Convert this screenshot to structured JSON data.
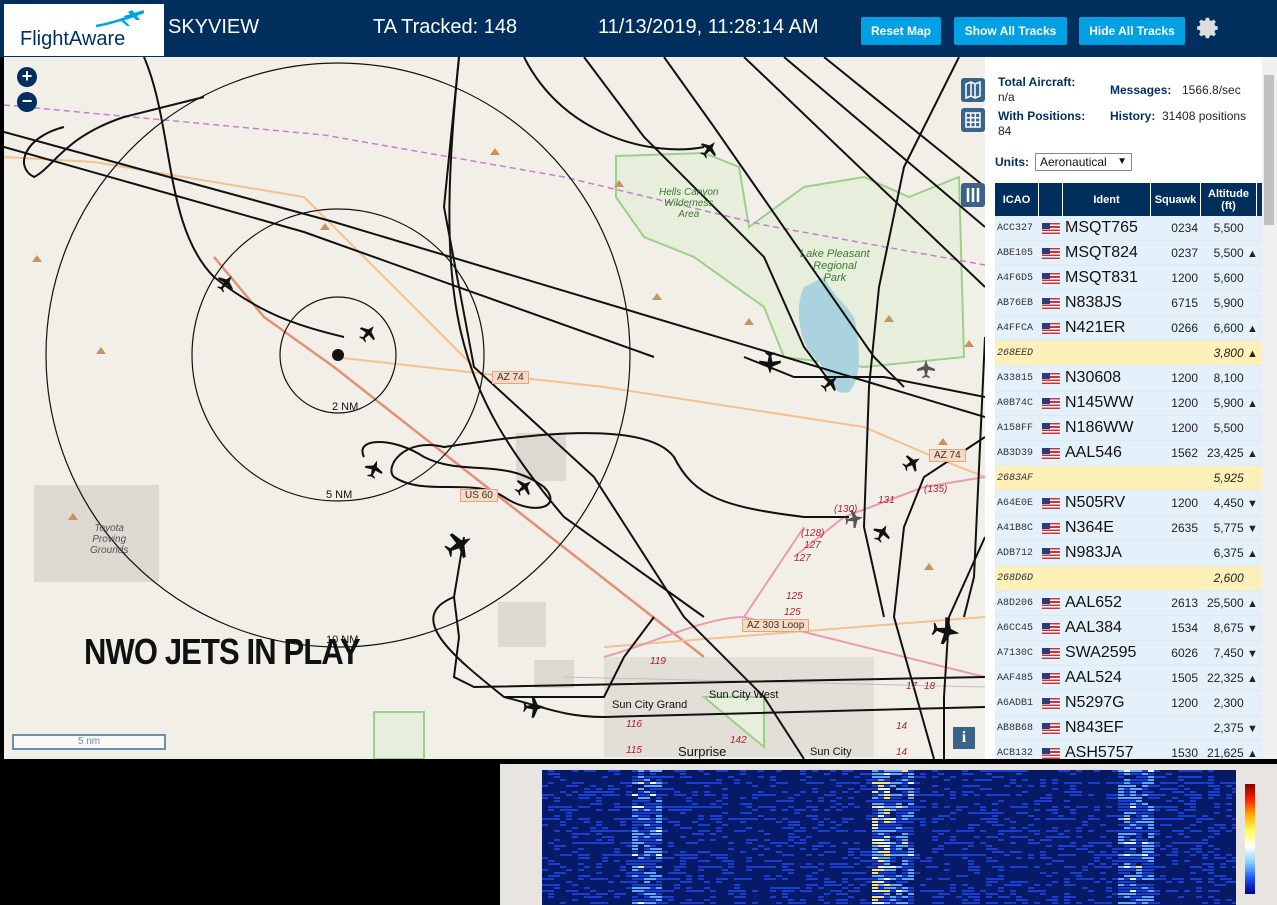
{
  "header": {
    "logo_text": "FlightAware",
    "app_name": "SKYVIEW",
    "tracked": "TA Tracked: 148",
    "datetime": "11/13/2019, 11:28:14 AM",
    "buttons": {
      "reset": "Reset Map",
      "show_all": "Show All Tracks",
      "hide_all": "Hide All Tracks"
    }
  },
  "map": {
    "overlay_caption": "NWO JETS IN PLAY",
    "zoom_in": "+",
    "zoom_out": "−",
    "scale_label": "5 nm",
    "info_label": "i",
    "rings": [
      "2 NM",
      "5 NM",
      "10 NM"
    ],
    "labels": {
      "hells_canyon": "Hells Canyon\nWilderness\nArea",
      "lake_pleasant": "Lake Pleasant\nRegional\nPark",
      "toyota": "Toyota\nProving\nGrounds",
      "sun_city_grand": "Sun City Grand",
      "sun_city_west": "Sun City West",
      "surprise": "Surprise",
      "sun_city": "Sun City"
    },
    "roads": {
      "az74_a": "AZ 74",
      "az74_b": "AZ 74",
      "us60": "US 60",
      "az303": "AZ 303 Loop"
    },
    "route_numbers": [
      "(130)",
      "131",
      "(135)",
      "(128)",
      "127",
      "127",
      "125",
      "125",
      "119",
      "116",
      "115",
      "142",
      "14",
      "14",
      "17",
      "18"
    ]
  },
  "sidebar": {
    "total_aircraft_label": "Total Aircraft:",
    "total_aircraft_value": "n/a",
    "messages_label": "Messages:",
    "messages_value": "1566.8/sec",
    "with_positions_label": "With Positions:",
    "with_positions_value": "84",
    "history_label": "History:",
    "history_value": "31408 positions",
    "units_label": "Units:",
    "units_value": "Aeronautical",
    "columns": [
      "ICAO",
      "",
      "Ident",
      "Squawk",
      "Altitude (ft)"
    ],
    "rows": [
      {
        "icao": "ACC327",
        "flag": true,
        "ident": "MSQT765",
        "squawk": "0234",
        "alt": "5,500",
        "trend": "",
        "gold": false
      },
      {
        "icao": "ABE105",
        "flag": true,
        "ident": "MSQT824",
        "squawk": "0237",
        "alt": "5,500",
        "trend": "▲",
        "gold": false
      },
      {
        "icao": "A4F6D5",
        "flag": true,
        "ident": "MSQT831",
        "squawk": "1200",
        "alt": "5,600",
        "trend": "",
        "gold": false
      },
      {
        "icao": "AB76EB",
        "flag": true,
        "ident": "N838JS",
        "squawk": "6715",
        "alt": "5,900",
        "trend": "",
        "gold": false
      },
      {
        "icao": "A4FFCA",
        "flag": true,
        "ident": "N421ER",
        "squawk": "0266",
        "alt": "6,600",
        "trend": "▲",
        "gold": false
      },
      {
        "icao": "268EED",
        "flag": false,
        "ident": "",
        "squawk": "",
        "alt": "3,800",
        "trend": "▲",
        "gold": true
      },
      {
        "icao": "A33815",
        "flag": true,
        "ident": "N30608",
        "squawk": "1200",
        "alt": "8,100",
        "trend": "",
        "gold": false
      },
      {
        "icao": "A0B74C",
        "flag": true,
        "ident": "N145WW",
        "squawk": "1200",
        "alt": "5,900",
        "trend": "▲",
        "gold": false
      },
      {
        "icao": "A158FF",
        "flag": true,
        "ident": "N186WW",
        "squawk": "1200",
        "alt": "5,500",
        "trend": "",
        "gold": false
      },
      {
        "icao": "AB3D39",
        "flag": true,
        "ident": "AAL546",
        "squawk": "1562",
        "alt": "23,425",
        "trend": "▲",
        "gold": false
      },
      {
        "icao": "2683AF",
        "flag": false,
        "ident": "",
        "squawk": "",
        "alt": "5,925",
        "trend": "",
        "gold": true
      },
      {
        "icao": "A64E0E",
        "flag": true,
        "ident": "N505RV",
        "squawk": "1200",
        "alt": "4,450",
        "trend": "▼",
        "gold": false
      },
      {
        "icao": "A41B8C",
        "flag": true,
        "ident": "N364E",
        "squawk": "2635",
        "alt": "5,775",
        "trend": "▼",
        "gold": false
      },
      {
        "icao": "ADB712",
        "flag": true,
        "ident": "N983JA",
        "squawk": "",
        "alt": "6,375",
        "trend": "▲",
        "gold": false
      },
      {
        "icao": "268D6D",
        "flag": false,
        "ident": "",
        "squawk": "",
        "alt": "2,600",
        "trend": "",
        "gold": true
      },
      {
        "icao": "A8D206",
        "flag": true,
        "ident": "AAL652",
        "squawk": "2613",
        "alt": "25,500",
        "trend": "▲",
        "gold": false
      },
      {
        "icao": "A6CC45",
        "flag": true,
        "ident": "AAL384",
        "squawk": "1534",
        "alt": "8,675",
        "trend": "▼",
        "gold": false
      },
      {
        "icao": "A7130C",
        "flag": true,
        "ident": "SWA2595",
        "squawk": "6026",
        "alt": "7,450",
        "trend": "▼",
        "gold": false
      },
      {
        "icao": "AAF485",
        "flag": true,
        "ident": "AAL524",
        "squawk": "1505",
        "alt": "22,325",
        "trend": "▲",
        "gold": false
      },
      {
        "icao": "A6ADB1",
        "flag": true,
        "ident": "N5297G",
        "squawk": "1200",
        "alt": "2,300",
        "trend": "",
        "gold": false
      },
      {
        "icao": "AB8B68",
        "flag": true,
        "ident": "N843EF",
        "squawk": "",
        "alt": "2,375",
        "trend": "▼",
        "gold": false
      },
      {
        "icao": "ACB132",
        "flag": true,
        "ident": "ASH5757",
        "squawk": "1530",
        "alt": "21,625",
        "trend": "▲",
        "gold": false
      }
    ]
  },
  "colors": {
    "brand": "#002f5d",
    "button": "#00a0e2"
  }
}
